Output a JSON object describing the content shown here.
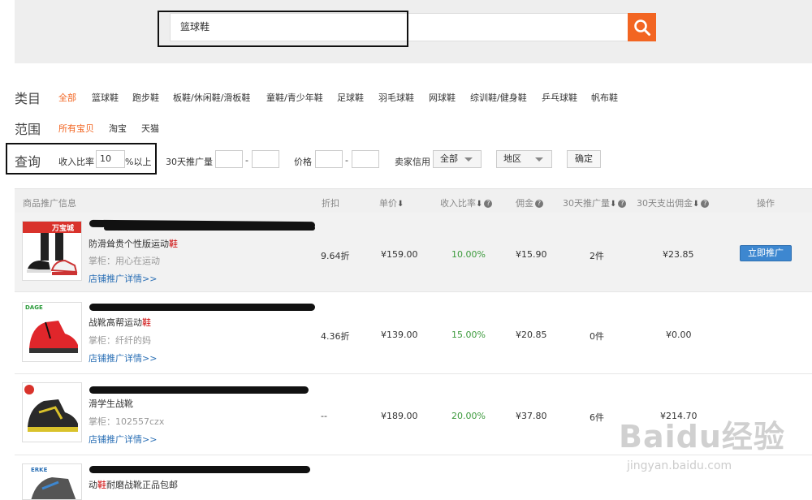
{
  "search": {
    "value": "篮球鞋"
  },
  "category": {
    "label": "类目",
    "items": [
      "全部",
      "篮球鞋",
      "跑步鞋",
      "板鞋/休闲鞋/滑板鞋",
      "童鞋/青少年鞋",
      "足球鞋",
      "羽毛球鞋",
      "网球鞋",
      "综训鞋/健身鞋",
      "乒乓球鞋",
      "帆布鞋"
    ]
  },
  "scope": {
    "label": "范围",
    "items": [
      "所有宝贝",
      "淘宝",
      "天猫"
    ]
  },
  "query": {
    "label": "查询",
    "ratio_label": "收入比率",
    "ratio_value": "10",
    "ratio_suffix": "%以上",
    "promo30_label": "30天推广量",
    "dash": "-",
    "price_label": "价格",
    "credit_label": "卖家信用",
    "credit_value": "全部",
    "region_value": "地区",
    "confirm_label": "确定"
  },
  "table": {
    "headers": {
      "info": "商品推广信息",
      "discount": "折扣",
      "price": "单价",
      "ratio": "收入比率",
      "commission": "佣金",
      "promo30": "30天推广量",
      "spend30": "30天支出佣金",
      "action": "操作"
    },
    "rows": [
      {
        "name_prefix": "防滑耸贵个性版运动",
        "name_kw": "鞋",
        "seller": "掌柜：用心在运动",
        "link": "店铺推广详情>>",
        "discount": "9.64折",
        "price": "¥159.00",
        "ratio": "10.00%",
        "commission": "¥15.90",
        "promo30": "2件",
        "spend30": "¥23.85",
        "action": "立即推广",
        "thumb_banner": "万宝城"
      },
      {
        "name_prefix": "战靴高帮运动",
        "name_kw": "鞋",
        "seller": "掌柜：纤纤的妈",
        "link": "店铺推广详情>>",
        "discount": "4.36折",
        "price": "¥139.00",
        "ratio": "15.00%",
        "commission": "¥20.85",
        "promo30": "0件",
        "spend30": "¥0.00",
        "thumb_banner": "DAGE"
      },
      {
        "name_prefix": "滑学生战靴",
        "name_kw": "",
        "seller": "掌柜：102557czx",
        "link": "店铺推广详情>>",
        "discount": "--",
        "price": "¥189.00",
        "ratio": "20.00%",
        "commission": "¥37.80",
        "promo30": "6件",
        "spend30": "¥214.70",
        "thumb_banner": ""
      },
      {
        "name_prefix": "动",
        "name_kw": "鞋",
        "name_suffix": "耐磨战靴正品包邮",
        "thumb_banner": "ERKE"
      }
    ]
  },
  "watermark": {
    "main": "Baidu经验",
    "sub": "jingyan.baidu.com"
  },
  "colors": {
    "accent": "#f26522",
    "link": "#2a6fb5",
    "ratio": "#3c9a3c",
    "button": "#3d87d0"
  }
}
